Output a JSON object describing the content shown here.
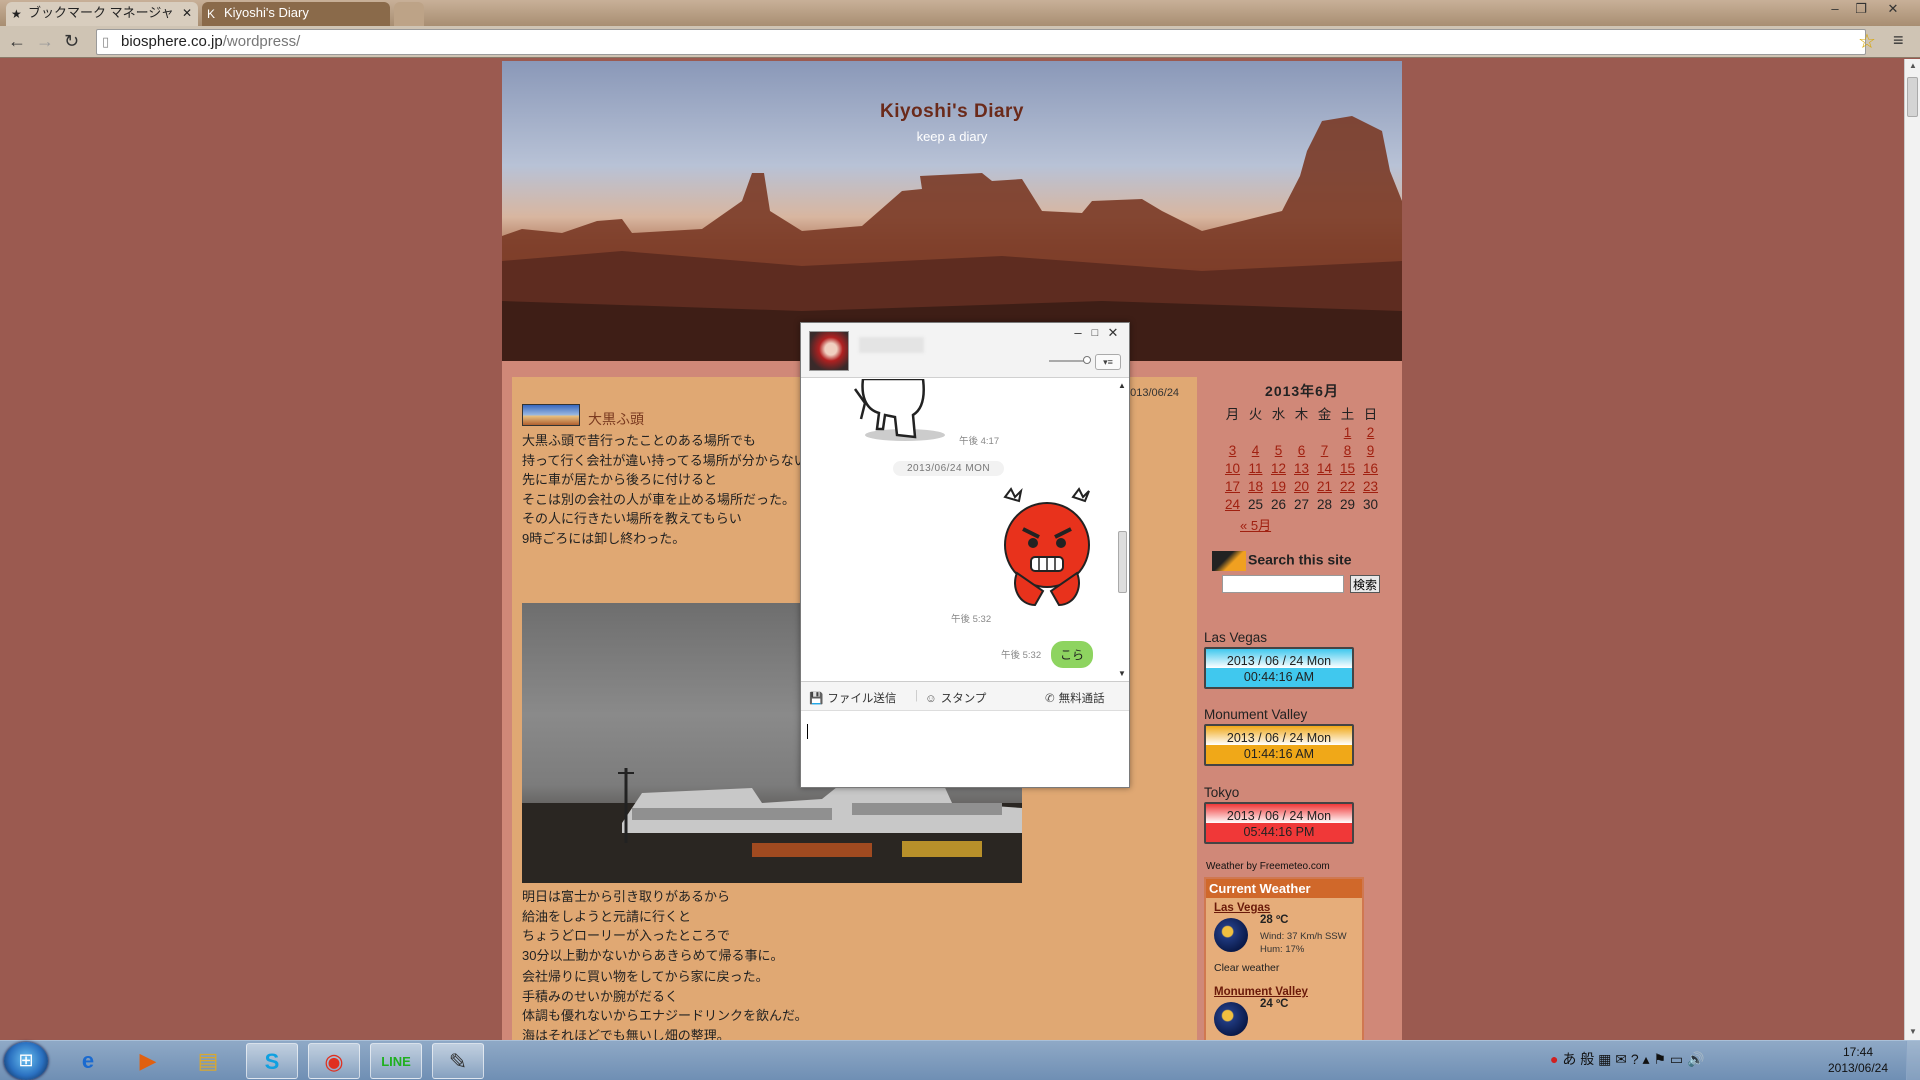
{
  "browser": {
    "tabs": [
      {
        "icon": "★",
        "title": "ブックマーク マネージャ",
        "active": false
      },
      {
        "icon": "K",
        "title": "Kiyoshi's Diary",
        "active": true
      }
    ],
    "url_host": "biosphere.co.jp",
    "url_path": "/wordpress/"
  },
  "blog": {
    "title": "Kiyoshi's Diary",
    "tagline": "keep a diary",
    "post": {
      "date": "2013/06/24",
      "title": "大黒ふ頭",
      "paragraph1": [
        "大黒ふ頭で昔行ったことのある場所でも",
        "持って行く会社が違い持ってる場所が分からない",
        "先に車が居たから後ろに付けると",
        "そこは別の会社の人が車を止める場所だった。",
        "その人に行きたい場所を教えてもらい",
        "9時ごろには卸し終わった。"
      ],
      "paragraph2": [
        "明日は富士から引き取りがあるから",
        "給油をしようと元請に行くと",
        "ちょうどローリーが入ったところで",
        "30分以上動かないからあきらめて帰る事に。"
      ],
      "paragraph3": [
        "会社帰りに買い物をしてから家に戻った。",
        "手積みのせいか腕がだるく",
        "体調も優れないからエナジードリンクを飲んだ。",
        "海はそれほどでも無いし畑の整理。"
      ]
    },
    "calendar": {
      "title": "2013年6月",
      "weekdays": [
        "月",
        "火",
        "水",
        "木",
        "金",
        "土",
        "日"
      ],
      "prev_link": "« 5月"
    },
    "search": {
      "heading": "Search this site",
      "button": "検索"
    },
    "clocks": [
      {
        "city": "Las Vegas",
        "date": "2013 / 06 / 24  Mon",
        "time": "00:44:16 AM",
        "color": "#40c8ee"
      },
      {
        "city": "Monument Valley",
        "date": "2013 / 06 / 24  Mon",
        "time": "01:44:16 AM",
        "color": "#f0a818"
      },
      {
        "city": "Tokyo",
        "date": "2013 / 06 / 24  Mon",
        "time": "05:44:16 PM",
        "color": "#f03838"
      }
    ],
    "weather": {
      "credit": "Weather by Freemeteo.com",
      "heading": "Current Weather",
      "entries": [
        {
          "city": "Las Vegas",
          "temp": "28 ºC",
          "wind": "Wind: 37 Km/h SSW",
          "hum": "Hum: 17%",
          "condition": "Clear weather"
        },
        {
          "city": "Monument Valley",
          "temp": "24 ºC"
        }
      ]
    }
  },
  "line_chat": {
    "times": {
      "t1": "午後 4:17",
      "t2": "午後 5:32",
      "t3": "午後 5:32"
    },
    "date_separator": "2013/06/24 MON",
    "bubble": "こら",
    "tools": {
      "file": "ファイル送信",
      "stamp": "スタンプ",
      "call": "無料通話"
    }
  },
  "taskbar": {
    "clock_time": "17:44",
    "clock_date": "2013/06/24",
    "ime": "あ 般"
  }
}
